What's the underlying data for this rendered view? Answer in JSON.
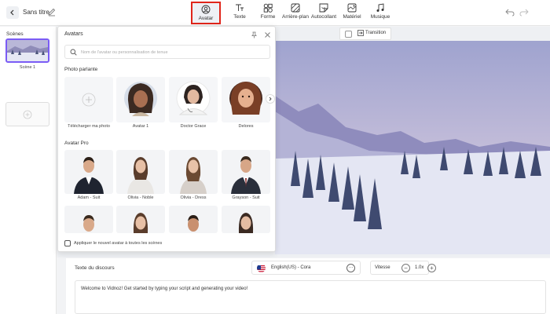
{
  "header": {
    "title": "Sans titre",
    "tools": [
      {
        "label": "Avatar",
        "icon": "avatar-icon"
      },
      {
        "label": "Texte",
        "icon": "text-icon"
      },
      {
        "label": "Forme",
        "icon": "shape-icon"
      },
      {
        "label": "Arrière-plan",
        "icon": "background-icon"
      },
      {
        "label": "Autocollant",
        "icon": "sticker-icon"
      },
      {
        "label": "Matériel",
        "icon": "material-icon"
      },
      {
        "label": "Musique",
        "icon": "music-icon"
      }
    ],
    "active_tool": "Avatar",
    "highlight_color": "#e0251b"
  },
  "scenes": {
    "title": "Scènes",
    "items": [
      {
        "label": "Scène 1"
      }
    ],
    "accent": "#7b5cf5"
  },
  "canvas": {
    "transition_label": "Transition"
  },
  "avatar_panel": {
    "title": "Avatars",
    "search_placeholder": "Nom de l'avatar ou personnalisation de tenue",
    "talking_photo": {
      "label": "Photo parlante",
      "items": [
        {
          "label": "Télécharger ma photo"
        },
        {
          "label": "Avatar 1"
        },
        {
          "label": "Doctor Grace"
        },
        {
          "label": "Delores"
        }
      ]
    },
    "pro": {
      "label": "Avatar Pro",
      "items": [
        {
          "label": "Adam - Suit"
        },
        {
          "label": "Olivia - Noble"
        },
        {
          "label": "Olivia - Dress"
        },
        {
          "label": "Grayson - Suit"
        }
      ]
    },
    "apply_all_label": "Appliquer le nouvel avatar à toutes les scènes"
  },
  "script": {
    "title": "Texte du discours",
    "voice": "English(US) - Cora",
    "speed_label": "Vitesse",
    "speed_value": "1.0x",
    "text": "Welcome to Vidnoz! Get started by typing your script and generating your video!"
  }
}
